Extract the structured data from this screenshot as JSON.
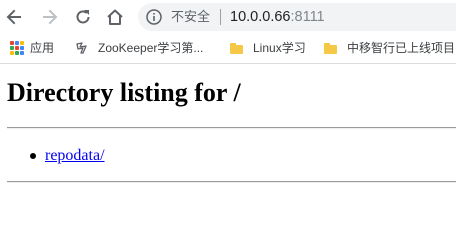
{
  "browser": {
    "security_label": "不安全",
    "url_host": "10.0.0.66",
    "url_port": ":8111"
  },
  "bookmarks": [
    {
      "label": "应用",
      "icon": "apps-grid-icon"
    },
    {
      "label": "ZooKeeper学习第...",
      "icon": "zookeeper-icon"
    },
    {
      "label": "Linux学习",
      "icon": "folder-icon"
    },
    {
      "label": "中移智行已上线项目",
      "icon": "folder-icon"
    }
  ],
  "page": {
    "title": "Directory listing for /",
    "entries": [
      {
        "label": "repodata/"
      }
    ]
  },
  "colors": {
    "link": "#0000ee",
    "omnibox_bg": "#f1f3f4"
  }
}
